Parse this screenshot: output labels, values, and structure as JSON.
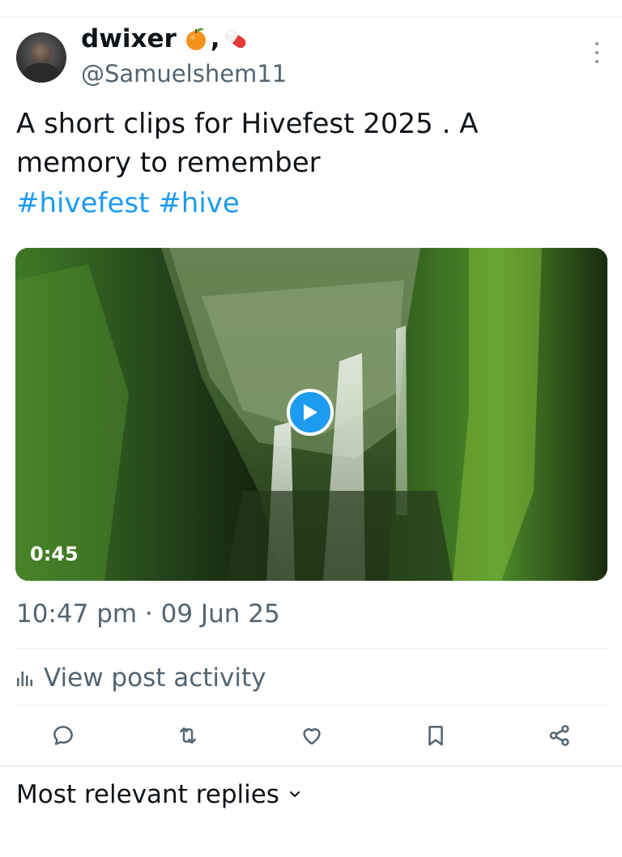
{
  "author": {
    "display_name": "dwixer",
    "handle": "@Samuelshem11",
    "name_emojis": [
      "orange-emoji",
      "pill-emoji"
    ],
    "name_separator": ","
  },
  "tweet": {
    "text": "A short clips for Hivefest 2025 . A memory to remember",
    "hashtags": [
      "#hivefest",
      "#hive"
    ],
    "video_duration": "0:45",
    "timestamp": "10:47 pm · 09 Jun 25"
  },
  "activity": {
    "label": "View post activity",
    "icon": "analytics-icon"
  },
  "actions": [
    {
      "name": "reply-icon"
    },
    {
      "name": "repost-icon"
    },
    {
      "name": "like-icon"
    },
    {
      "name": "bookmark-icon"
    },
    {
      "name": "share-icon"
    }
  ],
  "replies": {
    "label": "Most relevant replies"
  },
  "colors": {
    "link": "#1d9bf0",
    "secondary_text": "#536471",
    "primary_text": "#0f1419"
  }
}
